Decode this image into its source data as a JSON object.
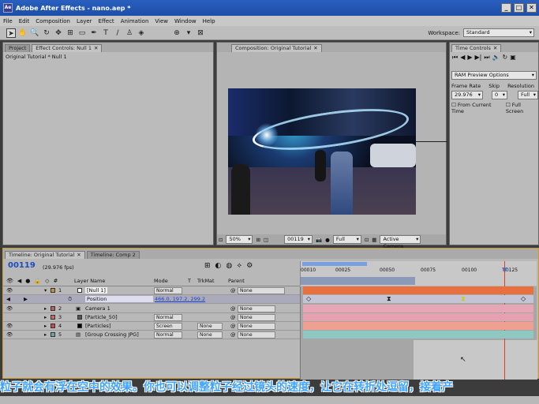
{
  "app": {
    "title": "Adobe After Effects - nano.aep *",
    "logo": "Ae"
  },
  "menu": [
    "File",
    "Edit",
    "Composition",
    "Layer",
    "Effect",
    "Animation",
    "View",
    "Window",
    "Help"
  ],
  "workspace": {
    "label": "Workspace:",
    "value": "Standard"
  },
  "project_panel": {
    "tabs": [
      "Project",
      "Effect Controls: Null 1"
    ],
    "subtitle": "Original Tutorial * Null 1"
  },
  "comp_panel": {
    "tab": "Composition: Original Tutorial",
    "zoom": "50%",
    "timecode": "00119",
    "quality": "Full",
    "camera": "Active Camera"
  },
  "time_controls": {
    "tab": "Time Controls",
    "preview": "RAM Preview Options",
    "frame_rate_label": "Frame Rate",
    "skip_label": "Skip",
    "resolution_label": "Resolution",
    "frame_rate": "29.976",
    "skip": "0",
    "resolution": "Full",
    "from_current": "From Current Time",
    "full_screen": "Full Screen"
  },
  "timeline": {
    "tabs": [
      "Timeline: Original Tutorial",
      "Timeline: Comp 2"
    ],
    "timecode": "00119",
    "fps": "(29.976 fps)",
    "headers": {
      "layer_name": "Layer Name",
      "mode": "Mode",
      "t": "T",
      "trkmat": "TrkMat",
      "parent": "Parent"
    },
    "ruler": [
      "00010",
      "00025",
      "00050",
      "00075",
      "00100",
      "00125"
    ],
    "layers": [
      {
        "num": "1",
        "name": "[Null 1]",
        "mode": "Normal",
        "trkmat": "",
        "parent": "None",
        "color": "#c8903a",
        "bar": "#e8703e"
      },
      {
        "num": "2",
        "name": "Camera 1",
        "mode": "",
        "trkmat": "",
        "parent": "None",
        "color": "#b86060",
        "bar": "#e7a6b6"
      },
      {
        "num": "3",
        "name": "[Particle_50]",
        "mode": "Normal",
        "trkmat": "None",
        "parent": "None",
        "color": "#c86868",
        "bar": "#e7a0b0"
      },
      {
        "num": "4",
        "name": "[Particles]",
        "mode": "Screen",
        "trkmat": "None",
        "parent": "None",
        "color": "#c84a4a",
        "bar": "#f0a090"
      },
      {
        "num": "5",
        "name": "[Group Crossing JPG]",
        "mode": "Normal",
        "trkmat": "None",
        "parent": "None",
        "color": "#6aa8a0",
        "bar": "#8fc8c0"
      }
    ],
    "position": {
      "label": "Position",
      "value": "466.0, 197.2, 299.2"
    }
  },
  "caption": "粒子就会有浮在空中的效果。你也可以调整粒子经过镜头的速度，让它在转折处逗留，接着产"
}
